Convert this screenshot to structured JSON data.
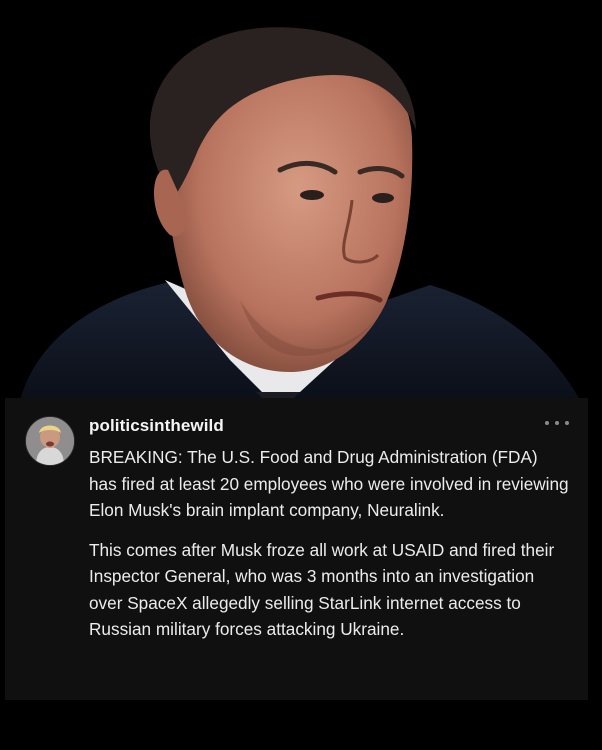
{
  "post": {
    "username": "politicsinthewild",
    "more_icon": "more-horizontal-icon",
    "paragraphs": [
      "BREAKING: The U.S. Food and Drug Administration (FDA) has fired at least 20 employees who were involved in reviewing Elon Musk's brain implant company, Neuralink.",
      "This comes after Musk froze all work at USAID and fired their Inspector General, who was 3 months into an investigation over SpaceX allegedly selling StarLink internet access to Russian military forces attacking Ukraine."
    ]
  },
  "colors": {
    "background": "#000000",
    "card": "#101010",
    "text": "#ececec",
    "username": "#f5f5f5",
    "icon": "#8a8a8a"
  }
}
